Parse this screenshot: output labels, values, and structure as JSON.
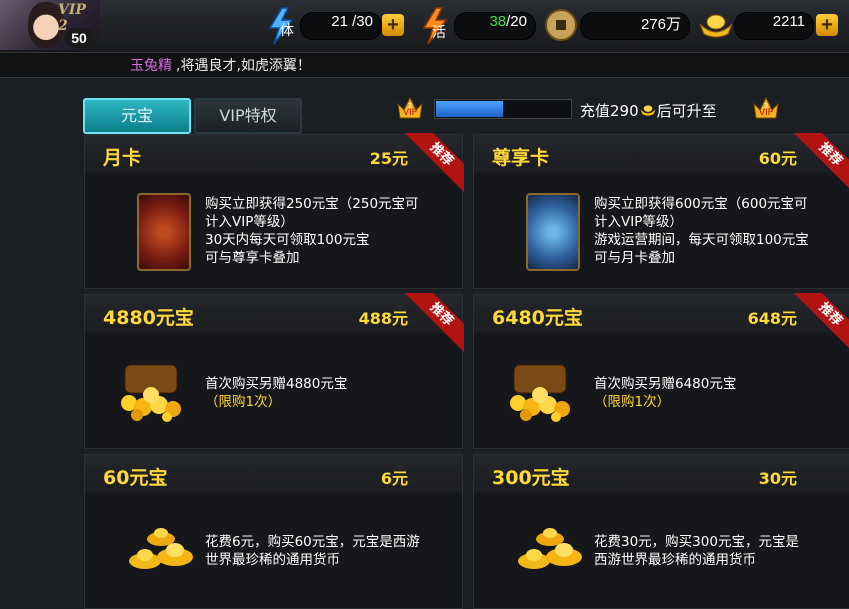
{
  "player": {
    "vip_label": "VIP 2",
    "level": "50"
  },
  "stats": {
    "stamina": {
      "icon": "stamina-icon",
      "label": "体",
      "current": "21",
      "max": "/30"
    },
    "energy": {
      "icon": "energy-icon",
      "label": "活",
      "current": "38",
      "max": "/20"
    },
    "coins": {
      "icon": "coin-icon",
      "value": "276万"
    },
    "ingots": {
      "icon": "ingot-icon",
      "value": "2211"
    }
  },
  "ticker": {
    "name": "玉兔精",
    "message": ",将遇良才,如虎添翼！"
  },
  "tabs": [
    {
      "label": "元宝"
    },
    {
      "label": "VIP特权"
    }
  ],
  "vip_progress": {
    "current_badge": "2",
    "next_badge": "3",
    "fill_fraction": 0.5,
    "text_before": "充值290",
    "text_after": "后可升至"
  },
  "cards": [
    {
      "title": "月卡",
      "price": "25元",
      "ribbon": "推荐",
      "image": "red-card",
      "desc": [
        "购买立即获得250元宝（250元宝可",
        "计入VIP等级）",
        "30天内每天可领取100元宝",
        "可与尊享卡叠加"
      ]
    },
    {
      "title": "尊享卡",
      "price": "60元",
      "ribbon": "推荐",
      "image": "blue-card",
      "desc": [
        "购买立即获得600元宝（600元宝可",
        "计入VIP等级）",
        "游戏运营期间，每天可领取100元宝",
        "可与月卡叠加"
      ]
    },
    {
      "title": "4880元宝",
      "price": "488元",
      "ribbon": "推荐",
      "image": "treasure-chest",
      "desc": [
        "首次购买另赠4880元宝",
        "（限购1次）"
      ]
    },
    {
      "title": "6480元宝",
      "price": "648元",
      "ribbon": "推荐",
      "image": "treasure-chest",
      "desc": [
        "首次购买另赠6480元宝",
        "（限购1次）"
      ]
    },
    {
      "title": "60元宝",
      "price": "6元",
      "ribbon": "",
      "image": "gold-ingots",
      "desc": [
        "花费6元，购买60元宝，元宝是西游",
        "世界最珍稀的通用货币"
      ]
    },
    {
      "title": "300元宝",
      "price": "30元",
      "ribbon": "",
      "image": "gold-ingots",
      "desc": [
        "花费30元，购买300元宝，元宝是",
        "西游世界最珍稀的通用货币"
      ]
    }
  ],
  "colors": {
    "accent": "#ffd83a",
    "tab_active": "#2db7c4",
    "ribbon": "#b21313"
  }
}
